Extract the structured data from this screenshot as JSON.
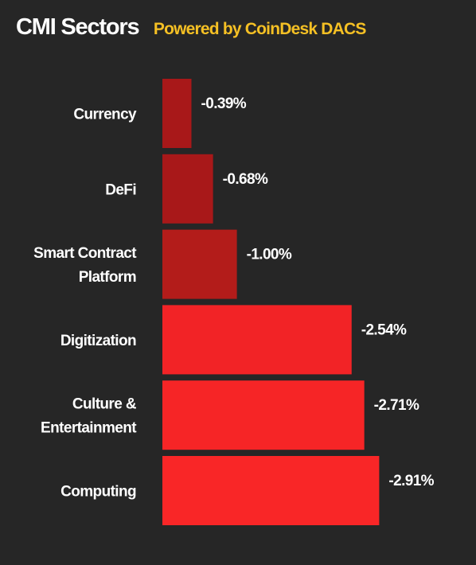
{
  "header": {
    "title": "CMI Sectors",
    "subtitle": "Powered by CoinDesk DACS"
  },
  "chart_data": {
    "type": "bar",
    "orientation": "horizontal",
    "title": "CMI Sectors",
    "subtitle": "Powered by CoinDesk DACS",
    "xlabel": "",
    "ylabel": "",
    "grid": false,
    "legend": "none",
    "categories": [
      [
        "Currency"
      ],
      [
        "DeFi"
      ],
      [
        "Smart Contract",
        "Platform"
      ],
      [
        "Digitization"
      ],
      [
        "Culture &",
        "Entertainment"
      ],
      [
        "Computing"
      ]
    ],
    "values": [
      -0.39,
      -0.68,
      -1.0,
      -2.54,
      -2.71,
      -2.91
    ],
    "value_labels": [
      "-0.39%",
      "-0.68%",
      "-1.00%",
      "-2.54%",
      "-2.71%",
      "-2.91%"
    ],
    "bar_colors": [
      "#a81819",
      "#a81819",
      "#b31c1a",
      "#f22326",
      "#f62526",
      "#f92627"
    ],
    "xlim": [
      0,
      -3.2
    ]
  },
  "colors": {
    "background": "#262626",
    "title": "#ffffff",
    "subtitle": "#f5c024"
  }
}
